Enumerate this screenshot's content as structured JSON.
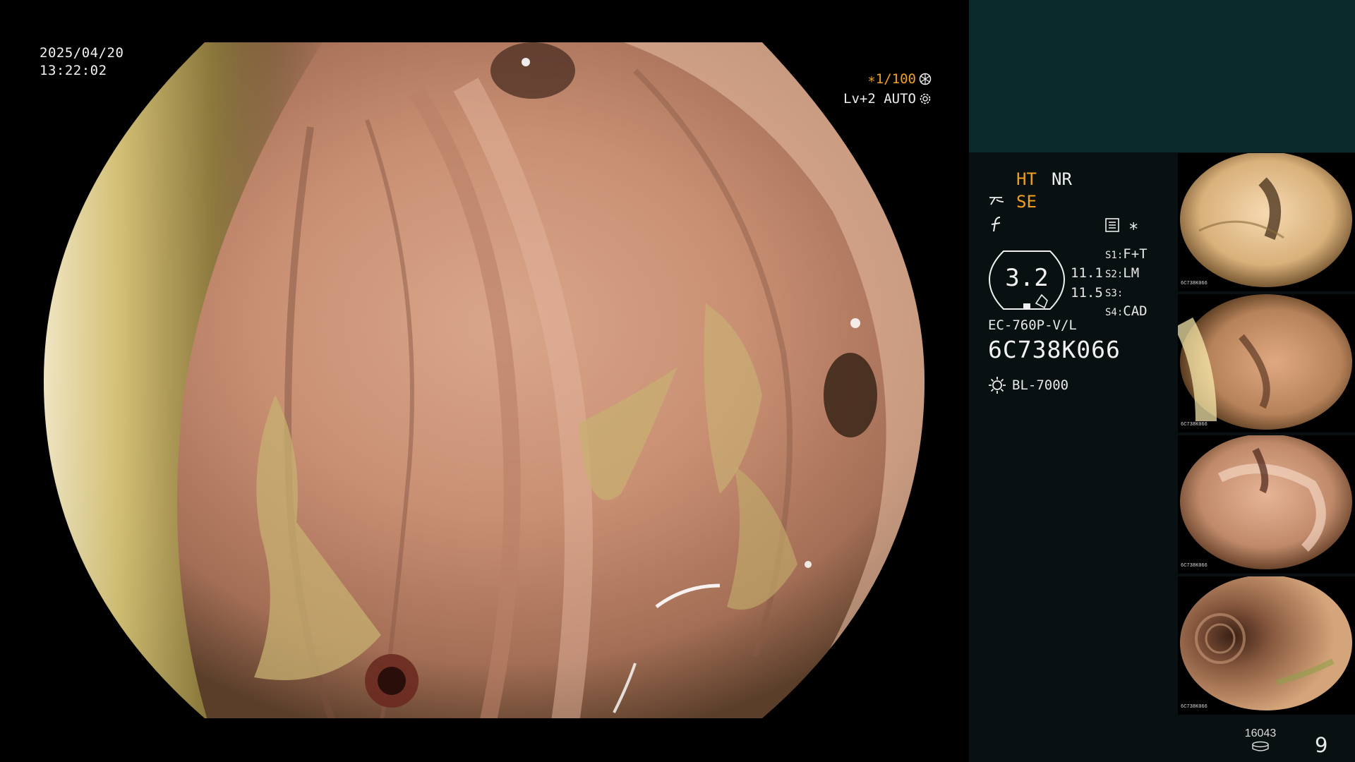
{
  "overlay": {
    "date": "2025/04/20",
    "time": "13:22:02",
    "shutter": "∗1/100",
    "light_level": "Lv+2 AUTO"
  },
  "status": {
    "ht_label": "HT",
    "nr_label": "NR",
    "se_label": "SE",
    "star": "∗",
    "gauge_value": "3.2",
    "reading_1": "11.1",
    "reading_2": "11.5"
  },
  "settings": [
    {
      "key": "S1:",
      "value": "F+T"
    },
    {
      "key": "S2:",
      "value": "LM"
    },
    {
      "key": "S3:",
      "value": ""
    },
    {
      "key": "S4:",
      "value": "CAD"
    }
  ],
  "scope": {
    "model": "EC-760P-V/L",
    "serial": "6C738K066",
    "light_source": "BL-7000"
  },
  "thumbnails": [
    {
      "name": "capture-1",
      "serial": "6C738K066"
    },
    {
      "name": "capture-2",
      "serial": "6C738K066"
    },
    {
      "name": "capture-3",
      "serial": "6C738K066"
    },
    {
      "name": "capture-4",
      "serial": "6C738K066"
    }
  ],
  "footer": {
    "counter": "16043",
    "page_number": "9"
  },
  "colors": {
    "accent_orange": "#f0a020",
    "panel_top": "#0b2a2c",
    "panel_bottom": "#081011",
    "text": "#e8e8e8"
  },
  "icons": {
    "shutter_icon": "aperture-icon",
    "lv_icon": "gear-icon",
    "se_icon": "edge-enhance-icon",
    "f_icon": "freeze-icon",
    "doc_icon": "report-icon",
    "light_icon": "lamp-icon",
    "storage_icon": "disk-icon"
  }
}
